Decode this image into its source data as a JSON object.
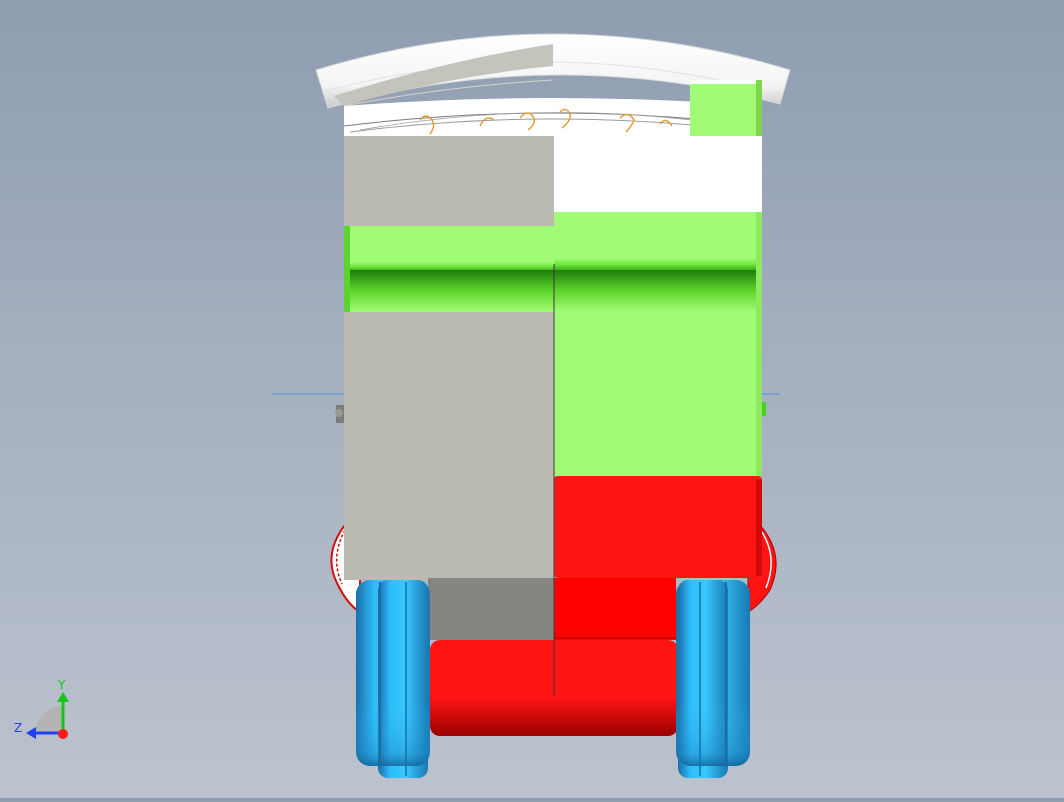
{
  "viewport": {
    "view": "front"
  },
  "triad": {
    "y_label": "Y",
    "z_label": "Z",
    "y_color": "#17c417",
    "z_color": "#1f3ff0",
    "x_color": "#ff1a1a"
  },
  "colors": {
    "roof": "#ffffff",
    "body_green": "#a2fb76",
    "body_green_dark": "#47d21c",
    "body_gray": "#bcbbb3",
    "body_gray_dark": "#868680",
    "red": "#ff1414",
    "wheel_blue": "#2fbdfb",
    "wheel_blue_dark": "#1b7fb8",
    "axis_line": "#4f8fe0"
  }
}
